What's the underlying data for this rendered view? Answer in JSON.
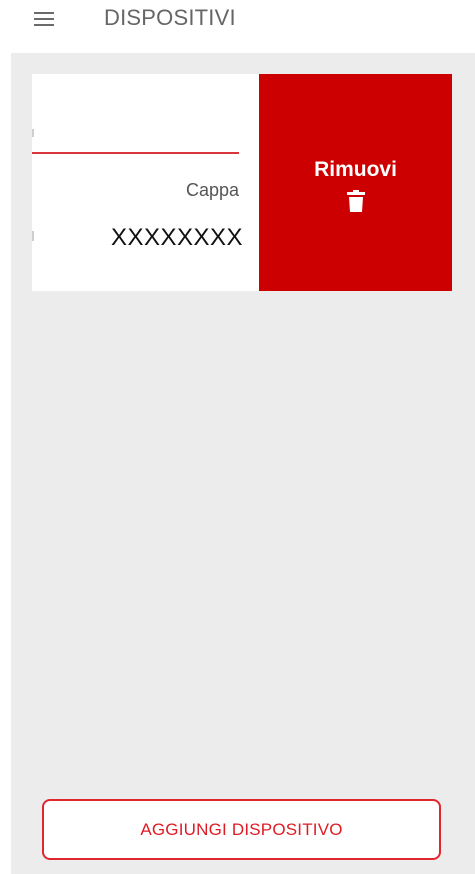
{
  "header": {
    "title": "DISPOSITIVI",
    "menu_icon": "hamburger-menu-icon"
  },
  "device_card": {
    "type": "Cappa",
    "code": "XXXXXXXX"
  },
  "swipe_action": {
    "label": "Rimuovi",
    "icon": "trash-icon",
    "color": "#cc0000"
  },
  "footer": {
    "add_label": "AGGIUNGI DISPOSITIVO",
    "accent": "#e01b24"
  }
}
